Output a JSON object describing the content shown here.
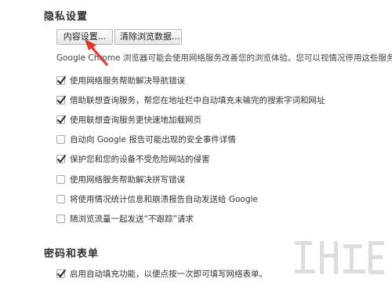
{
  "privacy": {
    "title": "隐私设置",
    "content_settings_button": "内容设置...",
    "clear_data_button": "清除浏览数据...",
    "description": "Google Chrome 浏览器可能会使用网络服务改善您的浏览体验。您可以视情况停用这些服务。",
    "options": [
      {
        "label": "使用网络服务帮助解决导航错误",
        "checked": true
      },
      {
        "label": "借助联想查询服务，帮您在地址栏中自动填充未输完的搜索字词和网址",
        "checked": true
      },
      {
        "label": "使用联想查询服务更快速地加载网页",
        "checked": true
      },
      {
        "label": "自动向 Google 报告可能出现的安全事件详情",
        "checked": false
      },
      {
        "label": "保护您和您的设备不受危险网站的侵害",
        "checked": true
      },
      {
        "label": "使用网络服务帮助解决拼写错误",
        "checked": false
      },
      {
        "label": "将使用情况统计信息和崩溃报告自动发送给 Google",
        "checked": false
      },
      {
        "label": "随浏览流量一起发送“不跟踪”请求",
        "checked": false
      }
    ]
  },
  "passwords": {
    "title": "密码和表单",
    "options": [
      {
        "label": "启用自动填充功能，以便点按一次即可填写网络表单。",
        "checked": true
      }
    ]
  },
  "colors": {
    "arrow": "#e8322b",
    "check": "#2b2b2b"
  },
  "icons": {
    "arrow": "red-arrow-annotation",
    "check": "checkmark-icon",
    "watermark": "watermark-logo"
  }
}
